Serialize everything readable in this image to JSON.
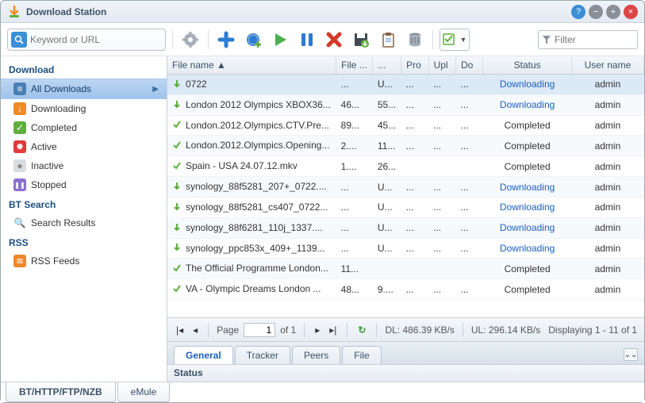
{
  "window": {
    "title": "Download Station"
  },
  "search": {
    "placeholder": "Keyword or URL"
  },
  "filter": {
    "placeholder": "Filter"
  },
  "toolbar_icons": [
    "gear",
    "plus",
    "globe-plus",
    "play",
    "pause",
    "delete",
    "save",
    "clipboard",
    "database",
    "check-menu"
  ],
  "sidebar": {
    "sections": [
      {
        "title": "Download",
        "items": [
          {
            "icon": "list",
            "color": "#fff",
            "bg": "#4a7fb5",
            "label": "All Downloads",
            "selected": true,
            "arrow": true
          },
          {
            "icon": "down",
            "color": "#fff",
            "bg": "#f08a24",
            "label": "Downloading"
          },
          {
            "icon": "check",
            "color": "#fff",
            "bg": "#5fae3f",
            "label": "Completed"
          },
          {
            "icon": "burst",
            "color": "#fff",
            "bg": "#e03a3a",
            "label": "Active"
          },
          {
            "icon": "dot",
            "color": "#888",
            "bg": "#d8dde2",
            "label": "Inactive"
          },
          {
            "icon": "pause",
            "color": "#fff",
            "bg": "#8a6fd1",
            "label": "Stopped"
          }
        ]
      },
      {
        "title": "BT Search",
        "items": [
          {
            "icon": "mag",
            "color": "#333",
            "bg": "transparent",
            "label": "Search Results"
          }
        ]
      },
      {
        "title": "RSS",
        "items": [
          {
            "icon": "rss",
            "color": "#fff",
            "bg": "#f0872a",
            "label": "RSS Feeds"
          }
        ]
      }
    ]
  },
  "grid": {
    "headers": [
      "File name ▲",
      "File ...",
      "...",
      "Pro",
      "Upl",
      "Do",
      "Status",
      "User name"
    ],
    "rows": [
      {
        "icon": "dl",
        "name": "0722",
        "fs": "...",
        "c2": "U...",
        "c3": "...",
        "c4": "...",
        "c5": "...",
        "status": "Downloading",
        "sd": true,
        "user": "admin",
        "sel": true
      },
      {
        "icon": "dl",
        "name": "London 2012 Olympics XBOX36...",
        "fs": "46...",
        "c2": "55...",
        "c3": "...",
        "c4": "...",
        "c5": "...",
        "status": "Downloading",
        "sd": true,
        "user": "admin"
      },
      {
        "icon": "ok",
        "name": "London.2012.Olympics.CTV.Pre...",
        "fs": "89...",
        "c2": "45...",
        "c3": "...",
        "c4": "...",
        "c5": "...",
        "status": "Completed",
        "user": "admin"
      },
      {
        "icon": "ok",
        "name": "London.2012.Olympics.Opening...",
        "fs": "2....",
        "c2": "11...",
        "c3": "...",
        "c4": "...",
        "c5": "...",
        "status": "Completed",
        "user": "admin"
      },
      {
        "icon": "ok",
        "name": "Spain - USA 24.07.12.mkv",
        "fs": "1....",
        "c2": "26...",
        "c3": "",
        "c4": "",
        "c5": "",
        "status": "Completed",
        "user": "admin"
      },
      {
        "icon": "dl",
        "name": "synology_88f5281_207+_0722....",
        "fs": "...",
        "c2": "U...",
        "c3": "...",
        "c4": "...",
        "c5": "...",
        "status": "Downloading",
        "sd": true,
        "user": "admin"
      },
      {
        "icon": "dl",
        "name": "synology_88f5281_cs407_0722...",
        "fs": "...",
        "c2": "U...",
        "c3": "...",
        "c4": "...",
        "c5": "...",
        "status": "Downloading",
        "sd": true,
        "user": "admin"
      },
      {
        "icon": "dl",
        "name": "synology_88f6281_110j_1337....",
        "fs": "...",
        "c2": "U...",
        "c3": "...",
        "c4": "...",
        "c5": "...",
        "status": "Downloading",
        "sd": true,
        "user": "admin"
      },
      {
        "icon": "dl",
        "name": "synology_ppc853x_409+_1139...",
        "fs": "...",
        "c2": "U...",
        "c3": "...",
        "c4": "...",
        "c5": "...",
        "status": "Downloading",
        "sd": true,
        "user": "admin"
      },
      {
        "icon": "ok",
        "name": "The Official Programme London...",
        "fs": "11...",
        "c2": "",
        "c3": "",
        "c4": "",
        "c5": "",
        "status": "Completed",
        "user": "admin"
      },
      {
        "icon": "ok",
        "name": "VA - Olympic Dreams London ...",
        "fs": "48...",
        "c2": "9....",
        "c3": "...",
        "c4": "...",
        "c5": "...",
        "status": "Completed",
        "user": "admin"
      }
    ]
  },
  "pager": {
    "page_label": "Page",
    "page": "1",
    "of_label": "of 1",
    "dl": "DL: 486.39 KB/s",
    "ul": "UL: 296.14 KB/s",
    "display": "Displaying 1 - 11 of 1"
  },
  "detail": {
    "tabs": [
      "General",
      "Tracker",
      "Peers",
      "File"
    ],
    "active": 0,
    "status_label": "Status"
  },
  "bottom_tabs": {
    "items": [
      "BT/HTTP/FTP/NZB",
      "eMule"
    ],
    "active": 0
  }
}
